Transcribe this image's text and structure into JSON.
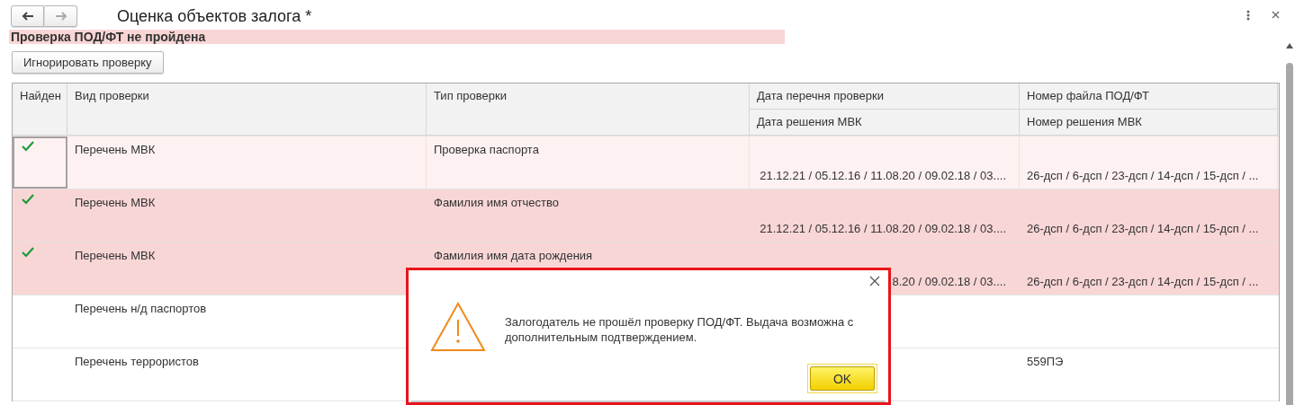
{
  "window": {
    "title": "Оценка объектов залога *"
  },
  "banner": {
    "text": "Проверка ПОД/ФТ не пройдена"
  },
  "toolbar": {
    "buttons": [
      "Игнорировать проверку"
    ]
  },
  "table": {
    "columns": {
      "found": "Найден",
      "check_list": "Вид проверки",
      "check_type": "Тип проверки",
      "list_date": "Дата перечня проверки",
      "decision_date": "Дата решения МВК",
      "file_number": "Номер файла ПОД/ФТ",
      "decision_number": "Номер решения МВК"
    },
    "rows": [
      {
        "found": true,
        "selected": true,
        "failed": true,
        "check_list": "Перечень МВК",
        "check_type": "Проверка паспорта",
        "decision_date": "21.12.21 / 05.12.16 / 11.08.20 / 09.02.18 / 03....",
        "decision_number": "26-дсп / 6-дсп / 23-дсп / 14-дсп / 15-дсп / ..."
      },
      {
        "found": true,
        "selected": false,
        "failed": true,
        "check_list": "Перечень МВК",
        "check_type": "Фамилия имя отчество",
        "decision_date": "21.12.21 / 05.12.16 / 11.08.20 / 09.02.18 / 03....",
        "decision_number": "26-дсп / 6-дсп / 23-дсп / 14-дсп / 15-дсп / ..."
      },
      {
        "found": true,
        "selected": false,
        "failed": true,
        "check_list": "Перечень МВК",
        "check_type": "Фамилия имя дата рождения",
        "decision_date": "8.20 / 09.02.18 / 03....",
        "decision_number": "26-дсп / 6-дсп / 23-дсп / 14-дсп / 15-дсп / ..."
      },
      {
        "found": false,
        "selected": false,
        "failed": false,
        "check_list": "Перечень н/д паспортов"
      },
      {
        "found": false,
        "selected": false,
        "failed": false,
        "check_list": "Перечень террористов",
        "file_number": "559ПЭ"
      }
    ]
  },
  "dialog": {
    "message": "Залогодатель не прошёл проверку ПОД/ФТ. Выдача возможна с дополнительным подтверждением.",
    "button": "OK"
  }
}
